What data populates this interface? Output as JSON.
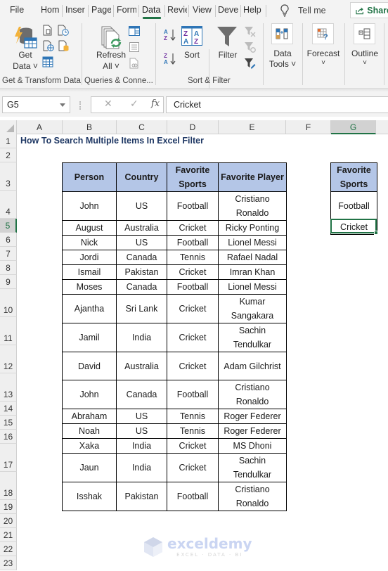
{
  "menu": {
    "tabs": [
      {
        "label": "File",
        "active": false
      },
      {
        "label": "Hom",
        "active": false
      },
      {
        "label": "Inser",
        "active": false
      },
      {
        "label": "Page",
        "active": false
      },
      {
        "label": "Form",
        "active": false
      },
      {
        "label": "Data",
        "active": true
      },
      {
        "label": "Revie",
        "active": false
      },
      {
        "label": "View",
        "active": false
      },
      {
        "label": "Deve",
        "active": false
      },
      {
        "label": "Help",
        "active": false
      }
    ],
    "tell_me": "Tell me",
    "share": "Share"
  },
  "ribbon": {
    "get_data": {
      "line1": "Get",
      "line2": "Data ˅"
    },
    "refresh_all": {
      "line1": "Refresh",
      "line2": "All ˅"
    },
    "sort": "Sort",
    "filter": "Filter",
    "data_tools": {
      "line1": "Data",
      "line2": "Tools ˅"
    },
    "forecast": {
      "line1": "Forecast",
      "line2": "˅"
    },
    "outline": {
      "line1": "Outline",
      "line2": "˅"
    },
    "groups": {
      "get_transform": "Get & Transform Data",
      "queries": "Queries & Conne...",
      "sort_filter": "Sort & Filter"
    },
    "accent": "#217346"
  },
  "formula_bar": {
    "name_box": "G5",
    "cancel_symbol": "✕",
    "enter_symbol": "✓",
    "fx_symbol": "fx",
    "value": "Cricket"
  },
  "sheet": {
    "columns": [
      "A",
      "B",
      "C",
      "D",
      "E",
      "F",
      "G"
    ],
    "selected_column": "G",
    "rows": [
      "1",
      "2",
      "3",
      "4",
      "5",
      "6",
      "7",
      "8",
      "9",
      "10",
      "11",
      "12",
      "13",
      "14",
      "15",
      "16",
      "17",
      "18",
      "19",
      "20",
      "21",
      "22",
      "23"
    ],
    "selected_row": "5",
    "title": "How To Search Multiple Items In Excel Filter",
    "header_fill": "#b4c6e7",
    "main_table": {
      "headers": [
        "Person",
        "Country",
        "Favorite Sports",
        "Favorite Player"
      ],
      "rows": [
        [
          "John",
          "US",
          "Football",
          "Cristiano Ronaldo"
        ],
        [
          "August",
          "Australia",
          "Cricket",
          "Ricky Ponting"
        ],
        [
          "Nick",
          "US",
          "Football",
          "Lionel Messi"
        ],
        [
          "Jordi",
          "Canada",
          "Tennis",
          "Rafael Nadal"
        ],
        [
          "Ismail",
          "Pakistan",
          "Cricket",
          "Imran Khan"
        ],
        [
          "Moses",
          "Canada",
          "Football",
          "Lionel Messi"
        ],
        [
          "Ajantha",
          "Sri Lank",
          "Cricket",
          "Kumar Sangakara"
        ],
        [
          "Jamil",
          "India",
          "Cricket",
          "Sachin Tendulkar"
        ],
        [
          "David",
          "Australia",
          "Cricket",
          "Adam Gilchrist"
        ],
        [
          "John",
          "Canada",
          "Football",
          "Cristiano Ronaldo"
        ],
        [
          "Abraham",
          "US",
          "Tennis",
          "Roger Federer"
        ],
        [
          "Noah",
          "US",
          "Tennis",
          "Roger Federer"
        ],
        [
          "Xaka",
          "India",
          "Cricket",
          "MS Dhoni"
        ],
        [
          "Jaun",
          "India",
          "Cricket",
          "Sachin Tendulkar"
        ],
        [
          "Isshak",
          "Pakistan",
          "Football",
          "Cristiano Ronaldo"
        ]
      ]
    },
    "criteria_table": {
      "header": "Favorite Sports",
      "values": [
        "Football",
        "Cricket"
      ]
    },
    "selected_cell": "G5"
  },
  "watermark": {
    "title": "exceldemy",
    "subtitle": "EXCEL · DATA · BI"
  }
}
